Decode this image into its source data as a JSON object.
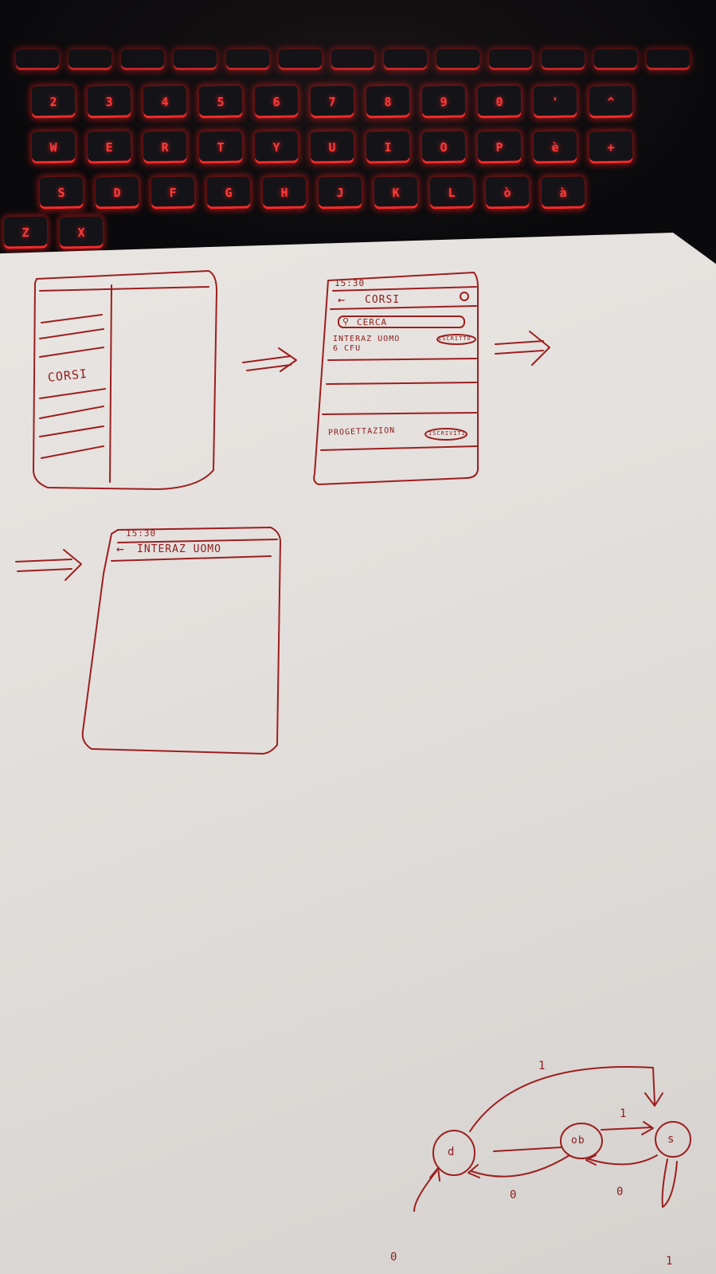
{
  "keyboard": {
    "row1": [
      "2",
      "3",
      "4",
      "5",
      "6",
      "7",
      "8",
      "9",
      "0",
      "'",
      "^"
    ],
    "row2": [
      "W",
      "E",
      "R",
      "T",
      "Y",
      "U",
      "I",
      "O",
      "P",
      "è",
      "+"
    ],
    "row3": [
      "S",
      "D",
      "F",
      "G",
      "H",
      "J",
      "K",
      "L",
      "ò",
      "à"
    ],
    "row4": [
      "Z",
      "X"
    ]
  },
  "sketch1": {
    "label": "CORSI"
  },
  "sketch2": {
    "status": "15:30",
    "header": "CORSI",
    "search": "CERCA",
    "item1_title": "INTERAZ UOMO",
    "item1_sub": "6 CFU",
    "item1_badge": "ISCRITTO",
    "item2_title": "PROGETTAZION",
    "item2_badge": "ISCRIVITI"
  },
  "sketch3": {
    "status": "15:30",
    "header": "INTERAZ UOMO"
  },
  "state_diagram": {
    "nodes": [
      "d",
      "ob",
      "s"
    ],
    "edge_labels": [
      "1",
      "1",
      "0",
      "0",
      "0",
      "1"
    ]
  },
  "colors": {
    "ink": "#9c1f1f",
    "paper": "#e6e2df",
    "keyglow": "#ff2a2a"
  }
}
